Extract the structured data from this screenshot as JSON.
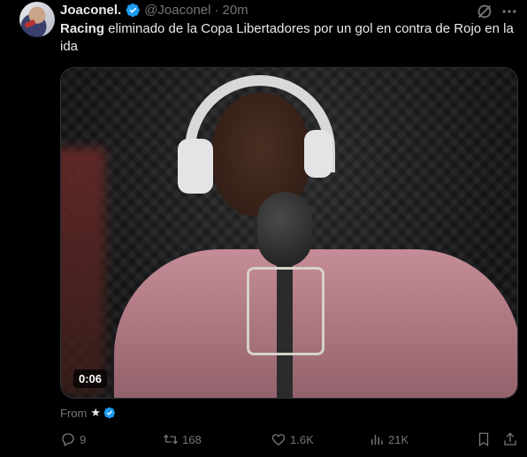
{
  "tweet": {
    "display_name": "Joaconel.",
    "handle": "@Joaconel",
    "separator": "·",
    "time": "20m",
    "text_bold": "Racing",
    "text_rest": " eliminado de la Copa Libertadores por un gol en contra de Rojo en la ida",
    "video_timestamp": "0:06",
    "from_label": "From",
    "from_star": "★"
  },
  "actions": {
    "replies": "9",
    "reposts": "168",
    "likes": "1.6K",
    "views": "21K"
  },
  "colors": {
    "background": "#000000",
    "text": "#e7e9ea",
    "muted": "#71767b",
    "verified": "#1d9bf0"
  },
  "icons": {
    "verified": "verified-badge-icon",
    "grok": "grok-icon",
    "more": "more-icon",
    "reply": "reply-icon",
    "repost": "repost-icon",
    "like": "heart-icon",
    "views": "views-icon",
    "bookmark": "bookmark-icon",
    "share": "share-icon"
  }
}
